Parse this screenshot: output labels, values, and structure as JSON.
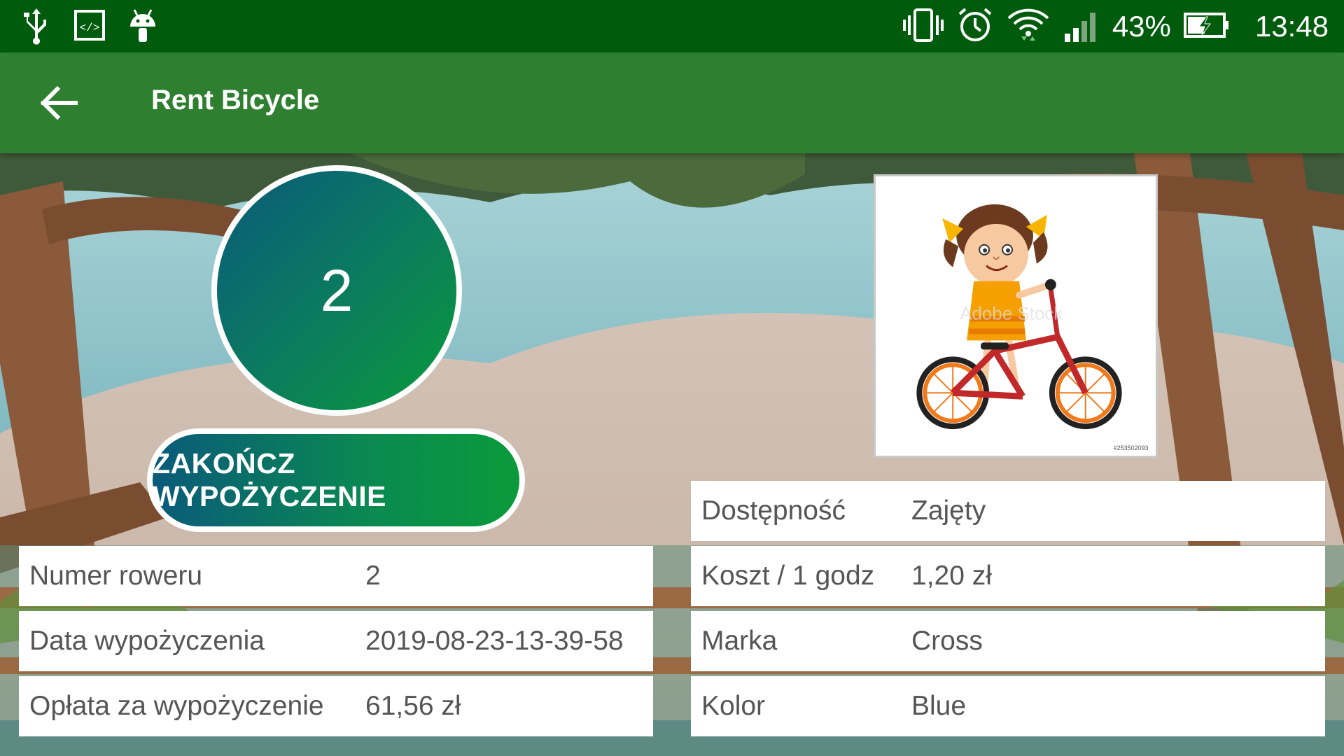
{
  "status_bar": {
    "left_icons": [
      "usb-icon",
      "code-icon",
      "android-icon"
    ],
    "battery_percent": "43%",
    "time": "13:48",
    "right_icons": [
      "vibrate-icon",
      "alarm-icon",
      "wifi-icon",
      "signal-icon",
      "battery-charging-icon"
    ]
  },
  "toolbar": {
    "title": "Rent Bicycle",
    "back_icon": "arrow-back-icon"
  },
  "counter": {
    "value": "2"
  },
  "end_button": {
    "label": "ZAKOŃCZ WYPOŻYCZENIE"
  },
  "bike_image": {
    "icon": "girl-on-bicycle-illustration"
  },
  "rental_info": [
    {
      "label": "Numer roweru",
      "value": "2"
    },
    {
      "label": "Data wypożyczenia",
      "value": "2019-08-23-13-39-58"
    },
    {
      "label": "Opłata za wypożyczenie",
      "value": "61,56 zł"
    }
  ],
  "bike_info": [
    {
      "label": "Dostępność",
      "value": "Zajęty"
    },
    {
      "label": "Koszt / 1 godz",
      "value": "1,20 zł"
    },
    {
      "label": "Marka",
      "value": "Cross"
    },
    {
      "label": "Kolor",
      "value": "Blue"
    }
  ],
  "colors": {
    "status_bar": "#005b0c",
    "toolbar": "#2f7f31",
    "gradient_start": "#0a5a7a",
    "gradient_end": "#0a9a3a"
  }
}
